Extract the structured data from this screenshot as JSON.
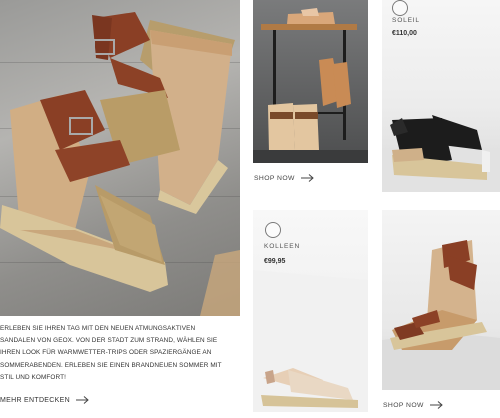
{
  "intro": {
    "lines": [
      "ERLEBEN SIE IHREN TAG MIT DEN NEUEN ATMUNGSAKTIVEN",
      "SANDALEN VON GEOX. VON DER STADT ZUM STRAND, WÄHLEN SIE",
      "IHREN LOOK FÜR WARMWETTER-TRIPS ODER SPAZIERGÄNGE AN",
      "SOMMERABENDEN. ERLEBEN SIE EINEN BRANDNEUEN SOMMER MIT",
      "STIL UND KOMFORT!"
    ],
    "more_label": "MEHR ENTDECKEN"
  },
  "tiles": {
    "lifestyle_top": {
      "shop_label": "SHOP NOW"
    },
    "soleil": {
      "name": "SOLEIL",
      "price": "€110,00"
    },
    "kolleen": {
      "name": "KOLLEEN",
      "price": "€99,95"
    },
    "lifestyle_bottom": {
      "shop_label": "SHOP NOW"
    }
  },
  "icons": {
    "arrow": "arrow-right-icon",
    "brand": "brand-logo-icon"
  },
  "colors": {
    "leather_brown": "#8a3f25",
    "suede_tan": "#b89b68",
    "cork": "#d4b38d",
    "jute": "#d8c59a",
    "black_strap": "#1c1c1c",
    "text": "#333333"
  }
}
